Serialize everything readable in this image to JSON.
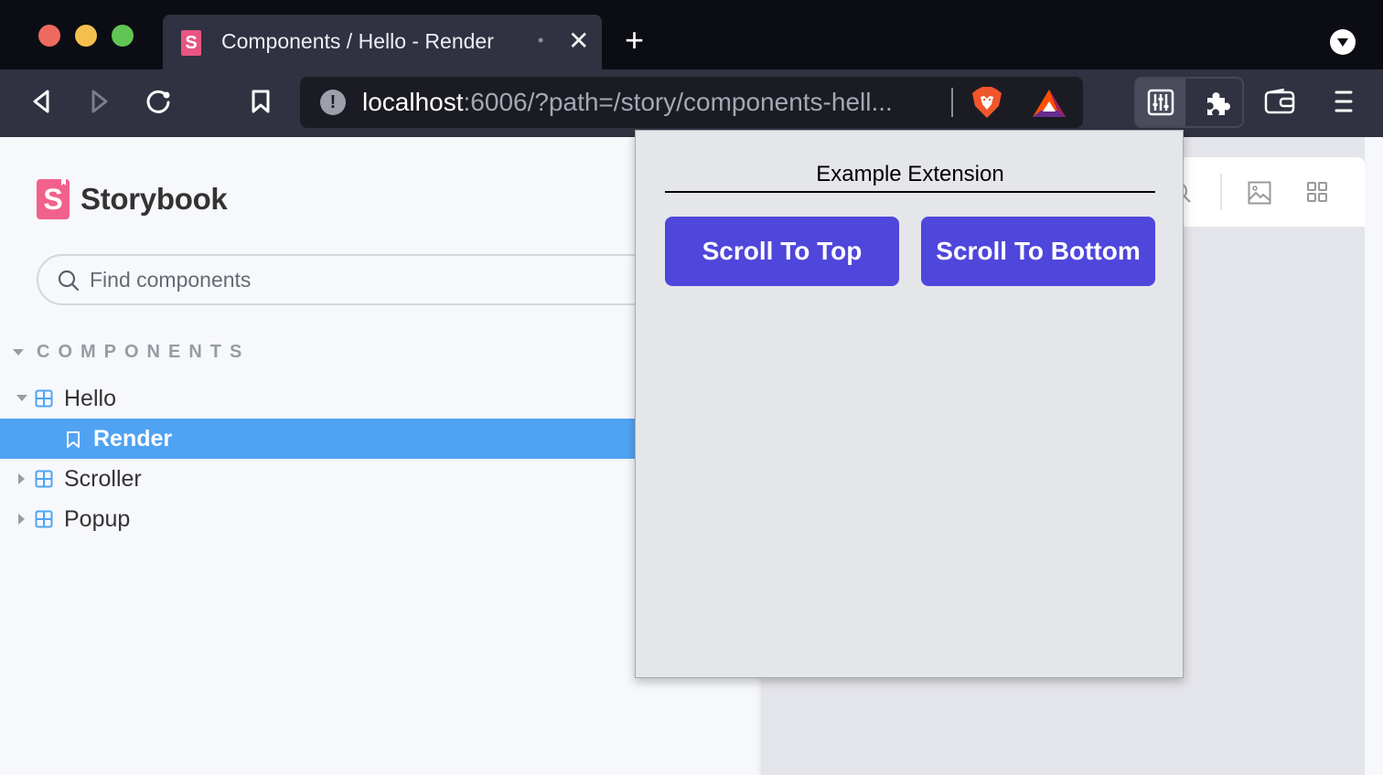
{
  "browser": {
    "tab": {
      "title": "Components / Hello - Render",
      "separator": "•",
      "close_glyph": "✕",
      "favicon_letter": "S"
    },
    "new_tab_glyph": "+",
    "toolbar": {
      "back_icon": "back-icon",
      "forward_icon": "forward-icon",
      "reload_icon": "reload-icon",
      "bookmark_icon": "bookmark-icon",
      "url_host": "localhost",
      "url_rest": ":6006/?path=/story/components-hell...",
      "info_glyph": "!",
      "extensions": [
        "extension-sliders-icon",
        "puzzle-icon"
      ],
      "wallet_icon": "wallet-icon",
      "menu_icon": "menu-icon"
    },
    "colors": {
      "tab_bar": "#0c0d14",
      "toolbar": "#303241",
      "url_bar": "#1b1c23"
    }
  },
  "storybook": {
    "logo_letter": "S",
    "logo_text": "Storybook",
    "search": {
      "placeholder": "Find components",
      "value": ""
    },
    "section": {
      "label": "COMPONENTS"
    },
    "tree": [
      {
        "label": "Hello",
        "type": "component",
        "expanded": true
      },
      {
        "label": "Render",
        "type": "story",
        "selected": true
      },
      {
        "label": "Scroller",
        "type": "component",
        "expanded": false
      },
      {
        "label": "Popup",
        "type": "component",
        "expanded": false
      }
    ],
    "colors": {
      "selected": "#50a3f3",
      "brand": "#f1618c",
      "component_icon": "#50a3f3"
    },
    "preview_toolbar_icons": [
      "zoom-icon",
      "background-icon",
      "grid-icon"
    ]
  },
  "popup": {
    "title": "Example Extension",
    "buttons": [
      {
        "label": "Scroll To Top"
      },
      {
        "label": "Scroll To Bottom"
      }
    ],
    "colors": {
      "button": "#4f46db",
      "background": "#e5e6ea"
    }
  }
}
